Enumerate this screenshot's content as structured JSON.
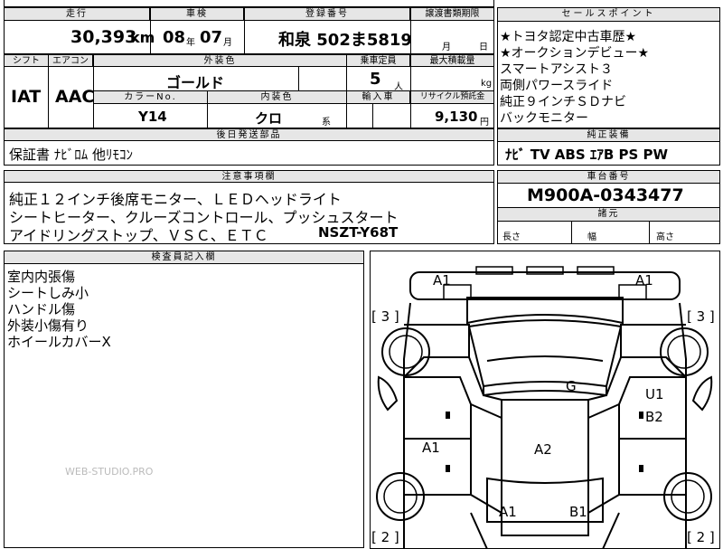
{
  "top": {
    "mileage_label": "走行",
    "mileage_value": "30,393",
    "mileage_unit": "km",
    "inspection_label": "車検",
    "inspection_year": "08",
    "inspection_year_unit": "年",
    "inspection_month": "07",
    "inspection_month_unit": "月",
    "plate_label": "登録番号",
    "plate_value": "和泉 502ま5819",
    "transfer_label": "譲渡書類期限",
    "transfer_month_unit": "月",
    "transfer_day_unit": "日"
  },
  "spec": {
    "shift_label": "シフト",
    "shift_value": "IAT",
    "aircon_label": "エアコン",
    "aircon_value": "AAC",
    "exterior_label": "外装色",
    "exterior_value": "ゴールド",
    "capacity_label": "乗車定員",
    "capacity_value": "5",
    "capacity_unit": "人",
    "load_label": "最大積載量",
    "load_unit": "kg",
    "color_no_label": "カラーNo.",
    "color_no_value": "Y14",
    "interior_label": "内装色",
    "interior_value": "クロ",
    "interior_suffix": "系",
    "import_label": "輸入車",
    "recycle_label": "リサイクル預託金",
    "recycle_value": "9,130",
    "recycle_unit": "円"
  },
  "later_parts": {
    "label": "後日発送部品",
    "value": "保証書 ﾅﾋﾞﾛﾑ 他ﾘﾓｺﾝ"
  },
  "notes": {
    "label": "注意事項欄",
    "lines": [
      "純正１２インチ後席モニター、ＬＥＤヘッドライト",
      "シートヒーター、クルーズコントロール、プッシュスタート",
      "アイドリングストップ、ＶＳＣ、ＥＴＣ"
    ],
    "model_code": "NSZT-Y68T"
  },
  "sales": {
    "label": "セールスポイント",
    "lines": [
      "★トヨタ認定中古車歴★",
      "★オークションデビュー★",
      "スマートアシスト３",
      "両側パワースライド",
      "純正９インチＳＤナビ",
      "バックモニター"
    ]
  },
  "equipment": {
    "label": "純正装備",
    "value": "ﾅﾋﾞ TV ABS ｴｱB PS PW"
  },
  "chassis": {
    "label": "車台番号",
    "value": "M900A-0343477"
  },
  "dims": {
    "label": "諸元",
    "length": "長さ",
    "width": "幅",
    "height": "高さ"
  },
  "inspector": {
    "label": "検査員記入欄",
    "lines": [
      "室内内張傷",
      "シートしみ小",
      "ハンドル傷",
      "外装小傷有り",
      "ホイールカバーX"
    ]
  },
  "watermark": "WEB-STUDIO.PRO",
  "diagram": {
    "marks": {
      "a1_top_left": "A1",
      "a1_top_right": "A1",
      "b_left_top": "[ 3 ]",
      "b_right_top": "[ 3 ]",
      "g": "G",
      "u1": "U1",
      "b2": "B2",
      "a1_left": "A1",
      "a2": "A2",
      "a1_bottom": "A1",
      "b1": "B1",
      "b_left_bottom": "[ 2 ]",
      "b_right_bottom": "[ 2 ]"
    }
  }
}
